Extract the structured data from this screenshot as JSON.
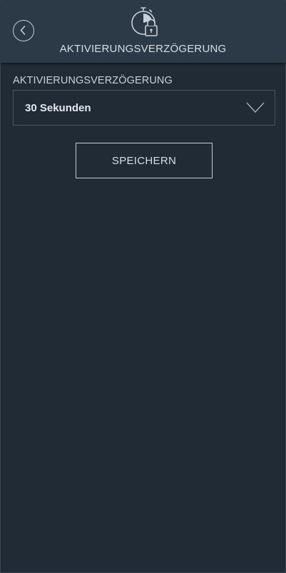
{
  "header": {
    "title": "AKTIVIERUNGSVERZÖGERUNG",
    "back_icon": "chevron-left-icon",
    "header_icon": "timer-lock-icon"
  },
  "form": {
    "label": "AKTIVIERUNGSVERZÖGERUNG",
    "select_value": "30 Sekunden",
    "select_icon": "chevron-down-icon"
  },
  "actions": {
    "save_label": "SPEICHERN"
  },
  "colors": {
    "background": "#202b36",
    "header_background": "#2c3a48",
    "text": "#d6dde4",
    "border": "#48535f"
  }
}
